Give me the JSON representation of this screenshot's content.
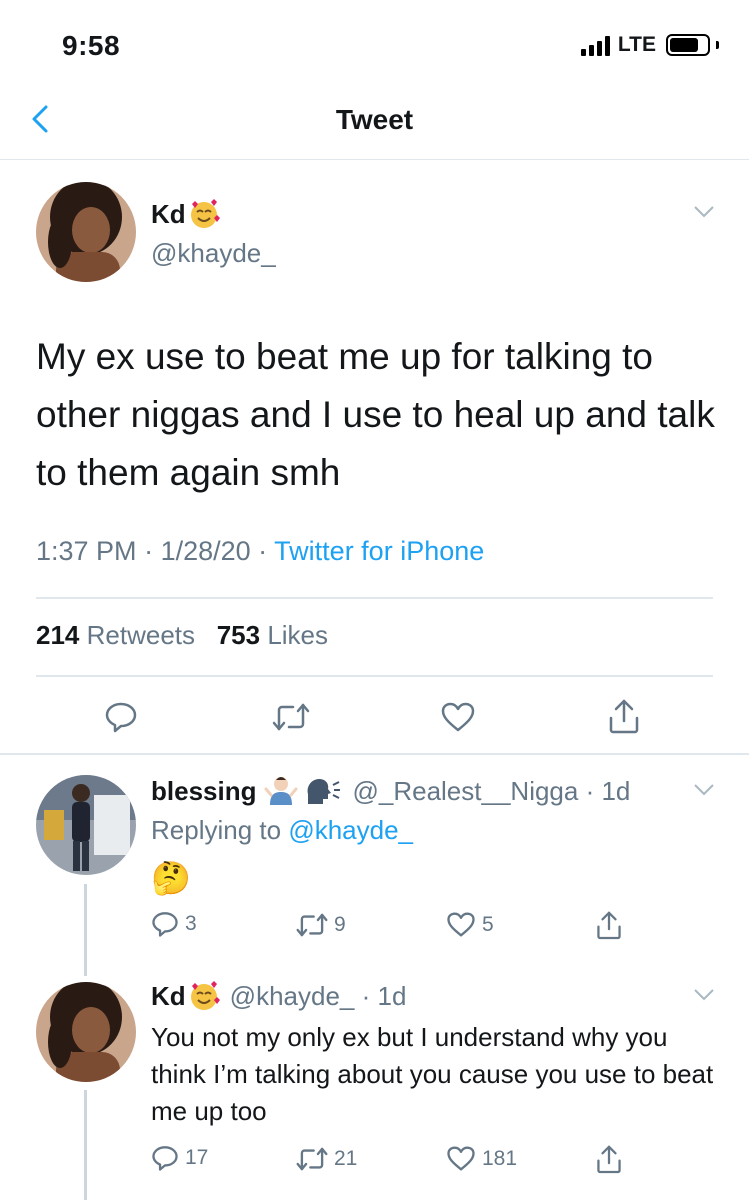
{
  "status_bar": {
    "time": "9:58",
    "network": "LTE"
  },
  "nav": {
    "title": "Tweet"
  },
  "tweet": {
    "author_name": "Kd",
    "handle": "@khayde_",
    "text": "My ex use to beat me up for talking to other niggas and I use to heal up and talk to them again smh",
    "time": "1:37 PM",
    "date": "1/28/20",
    "source": "Twitter for iPhone",
    "retweets_count": "214",
    "retweets_label": "Retweets",
    "likes_count": "753",
    "likes_label": "Likes"
  },
  "replies": [
    {
      "author_name": "blessing",
      "handle": "@_Realest__Nigga",
      "age": "1d",
      "replying_label": "Replying to",
      "replying_to": "@khayde_",
      "text": "🤔",
      "reply_count": "3",
      "retweet_count": "9",
      "like_count": "5"
    },
    {
      "author_name": "Kd",
      "handle": "@khayde_",
      "age": "1d",
      "text": "You not my only ex but I understand why you think I’m talking about you cause you use to beat me up too",
      "reply_count": "17",
      "retweet_count": "21",
      "like_count": "181"
    }
  ],
  "icons": {
    "back": "chevron-left-icon",
    "more": "chevron-down-icon",
    "reply": "reply-icon",
    "retweet": "retweet-icon",
    "like": "heart-icon",
    "share": "share-icon"
  },
  "colors": {
    "accent": "#1da1f2",
    "secondary_text": "#657786",
    "divider": "#e1e8ed"
  }
}
